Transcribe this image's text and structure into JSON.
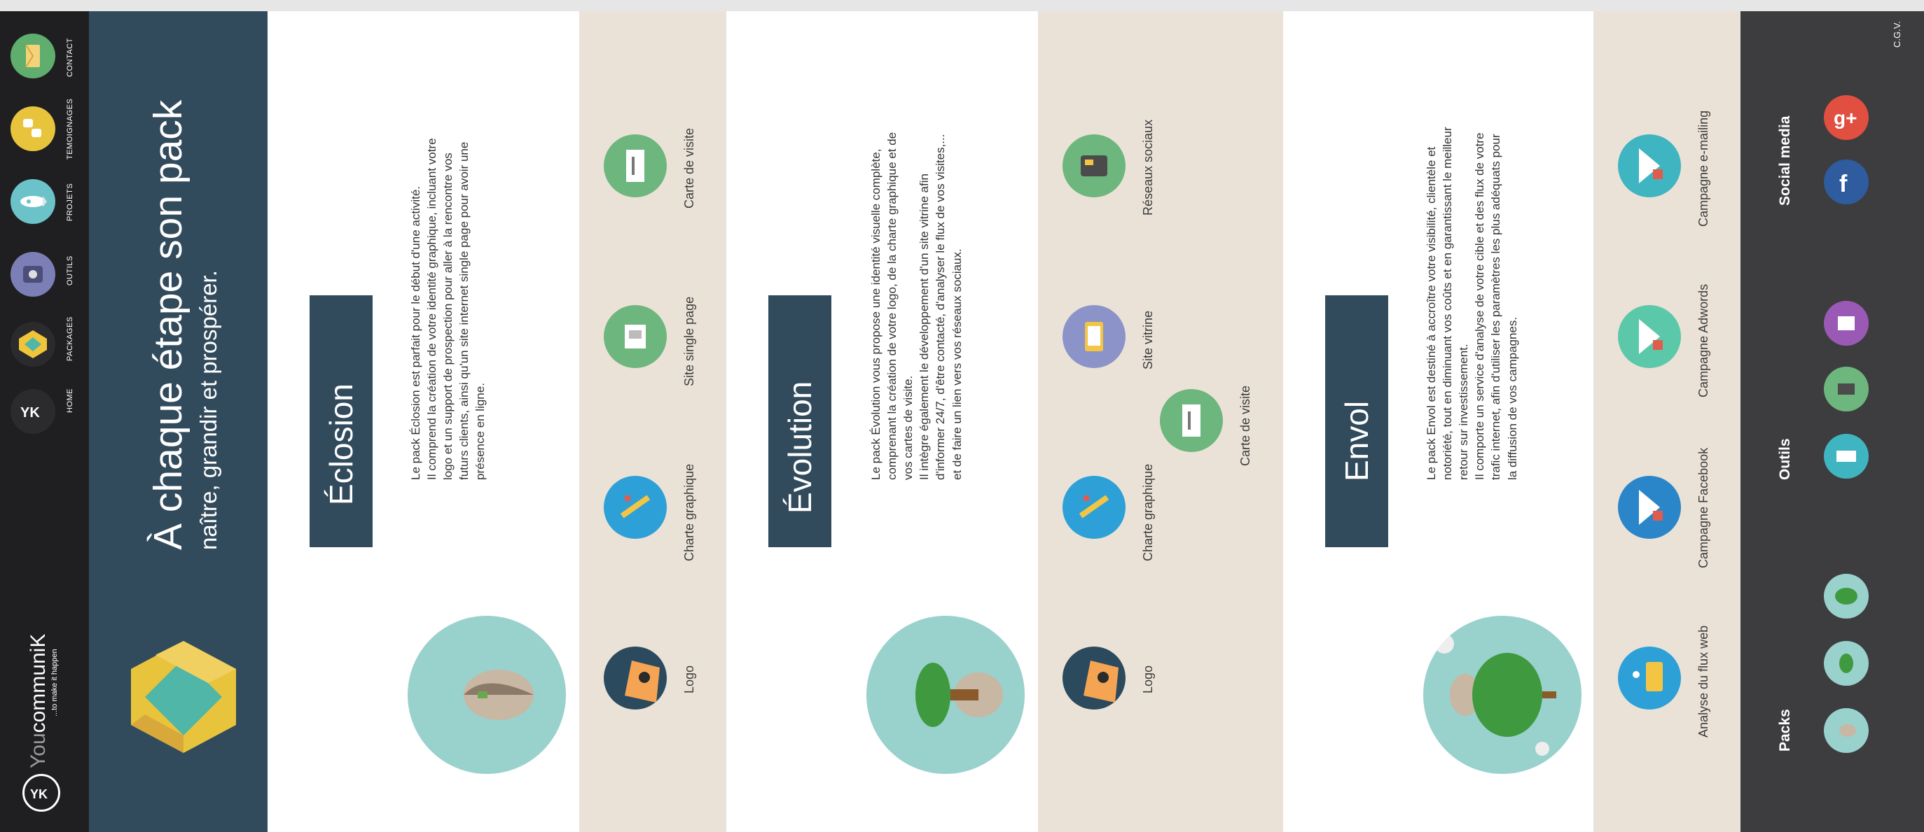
{
  "nav": {
    "items": [
      {
        "label": "CONTACT",
        "icon": "envelope-icon",
        "color": "#5fae6e"
      },
      {
        "label": "TEMOIGNAGES",
        "icon": "quote-icon",
        "color": "#e8c43d"
      },
      {
        "label": "PROJETS",
        "icon": "rocket-icon",
        "color": "#6bc2c9"
      },
      {
        "label": "OUTILS",
        "icon": "camera-icon",
        "color": "#7b7fb5"
      },
      {
        "label": "PACKAGES",
        "icon": "box-icon",
        "color": "#f0c53a"
      },
      {
        "label": "HOME",
        "icon": "logo-icon",
        "color": "#2b2b2e"
      }
    ],
    "brand": {
      "name_light": "You",
      "name_dark": "communi",
      "name_end": "K",
      "tagline": "...to make it happen"
    }
  },
  "hero": {
    "title": "À chaque étape son pack",
    "subtitle": "naître, grandir et prospérer."
  },
  "packs": [
    {
      "title": "Éclosion",
      "desc": [
        "Le pack Éclosion est parfait pour le début d'une activité.",
        "Il comprend la création de votre identité graphique, incluant votre",
        "logo et un support de prospection pour aller à la rencontre vos",
        "futurs clients, ainsi qu'un site internet single page pour avoir une",
        "présence en ligne."
      ],
      "services": [
        "Carte de visite",
        "Site single page",
        "Charte graphique",
        "Logo"
      ]
    },
    {
      "title": "Évolution",
      "desc": [
        "Le pack Évolution vous propose une identité visuelle complète,",
        "comprenant la création de votre logo, de la charte graphique et de",
        "vos cartes de visite.",
        "Il intègre également le développement d'un site vitrine afin",
        "d'informer 24/7, d'être contacté, d'analyser le flux de vos visites,...",
        "et de faire un lien vers vos réseaux sociaux."
      ],
      "services": [
        "Réseaux sociaux",
        "Site vitrine",
        "Carte de visite",
        "Charte graphique",
        "Logo"
      ]
    },
    {
      "title": "Envol",
      "desc": [
        "Le pack Envol est destiné à accroître votre visibilité, clientèle et",
        "notoriété, tout en diminuant vos coûts et en garantissant le meilleur",
        "retour sur investissement.",
        "Il comporte un service d'analyse de votre cible et des flux de votre",
        "trafic internet, afin d'utiliser les paramètres les plus adéquats pour",
        "la diffusion de vos campagnes."
      ],
      "services": [
        "Campagne e-mailing",
        "Campagne Adwords",
        "Campagne Facebook",
        "Analyse du flux web"
      ]
    }
  ],
  "sidebar": {
    "cgv": "C.G.V.",
    "social_heading": "Social media",
    "tools_heading": "Outils",
    "packs_heading": "Packs"
  }
}
